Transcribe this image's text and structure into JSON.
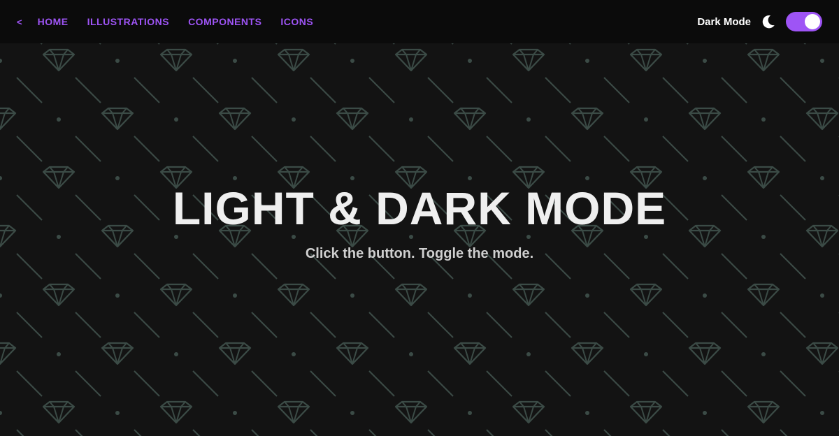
{
  "nav": {
    "back_label": "<",
    "links": [
      {
        "label": "HOME"
      },
      {
        "label": "ILLUSTRATIONS"
      },
      {
        "label": "COMPONENTS"
      },
      {
        "label": "ICONS"
      }
    ],
    "mode_label": "Dark Mode",
    "mode_icon": "moon-icon",
    "toggle_on": true
  },
  "hero": {
    "title": "LIGHT & DARK MODE",
    "subtitle": "Click the button. Toggle the mode."
  },
  "colors": {
    "background": "#131313",
    "navbar": "#0b0b0b",
    "accent": "#9e54f5",
    "pattern": "#3b4b46",
    "title": "#efefef",
    "subtitle": "#cfcfcf"
  }
}
